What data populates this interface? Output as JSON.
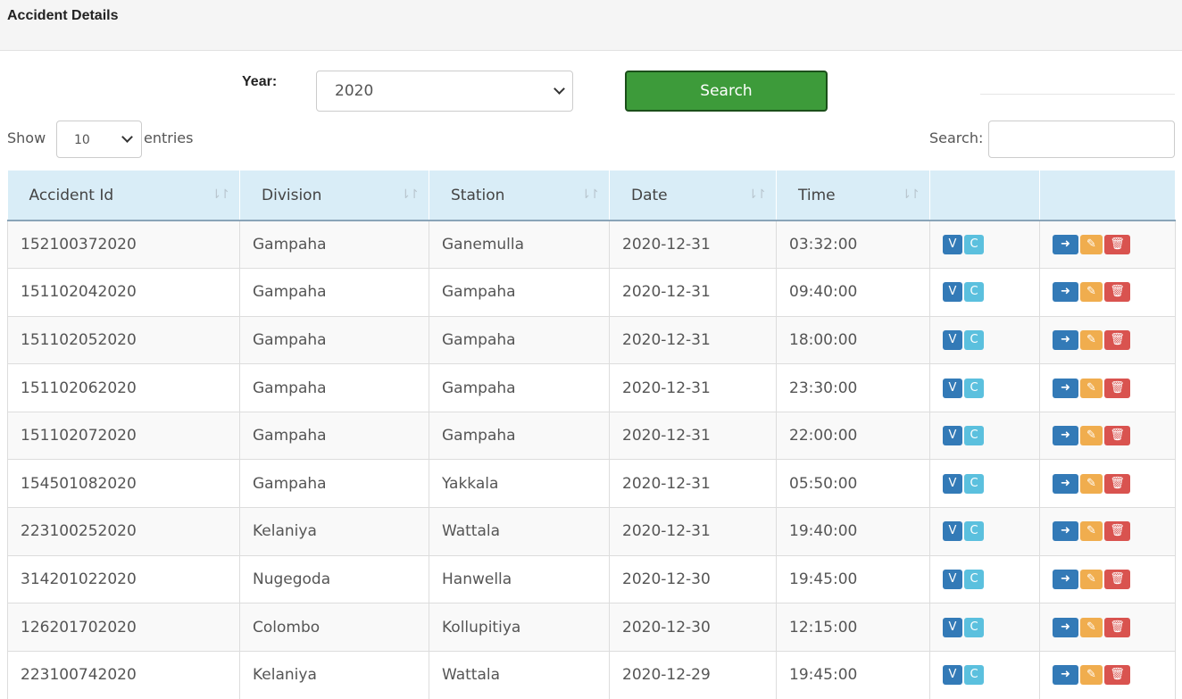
{
  "panel": {
    "title": "Accident Details"
  },
  "filter": {
    "year_label": "Year:",
    "year_value": "2020",
    "search_button": "Search"
  },
  "table_controls": {
    "show_label": "Show",
    "length_value": "10",
    "entries_label": "entries",
    "search_label": "Search:",
    "search_value": ""
  },
  "table": {
    "columns": [
      "Accident Id",
      "Division",
      "Station",
      "Date",
      "Time",
      "",
      ""
    ],
    "rows": [
      {
        "id": "152100372020",
        "division": "Gampaha",
        "station": "Ganemulla",
        "date": "2020-12-31",
        "time": "03:32:00"
      },
      {
        "id": "151102042020",
        "division": "Gampaha",
        "station": "Gampaha",
        "date": "2020-12-31",
        "time": "09:40:00"
      },
      {
        "id": "151102052020",
        "division": "Gampaha",
        "station": "Gampaha",
        "date": "2020-12-31",
        "time": "18:00:00"
      },
      {
        "id": "151102062020",
        "division": "Gampaha",
        "station": "Gampaha",
        "date": "2020-12-31",
        "time": "23:30:00"
      },
      {
        "id": "151102072020",
        "division": "Gampaha",
        "station": "Gampaha",
        "date": "2020-12-31",
        "time": "22:00:00"
      },
      {
        "id": "154501082020",
        "division": "Gampaha",
        "station": "Yakkala",
        "date": "2020-12-31",
        "time": "05:50:00"
      },
      {
        "id": "223100252020",
        "division": "Kelaniya",
        "station": "Wattala",
        "date": "2020-12-31",
        "time": "19:40:00"
      },
      {
        "id": "314201022020",
        "division": "Nugegoda",
        "station": "Hanwella",
        "date": "2020-12-30",
        "time": "19:45:00"
      },
      {
        "id": "126201702020",
        "division": "Colombo",
        "station": "Kollupitiya",
        "date": "2020-12-30",
        "time": "12:15:00"
      },
      {
        "id": "223100742020",
        "division": "Kelaniya",
        "station": "Wattala",
        "date": "2020-12-29",
        "time": "19:45:00"
      }
    ]
  },
  "row_buttons": {
    "view": "V",
    "c": "C",
    "go_icon": "arrow-right-icon",
    "edit_icon": "edit-icon",
    "delete_icon": "trash-icon"
  },
  "colors": {
    "search_button": "#3d9b3a",
    "header_bg": "#d9edf7",
    "primary": "#337ab7",
    "info": "#5bc0de",
    "warning": "#f0ad4e",
    "danger": "#d9534f"
  }
}
